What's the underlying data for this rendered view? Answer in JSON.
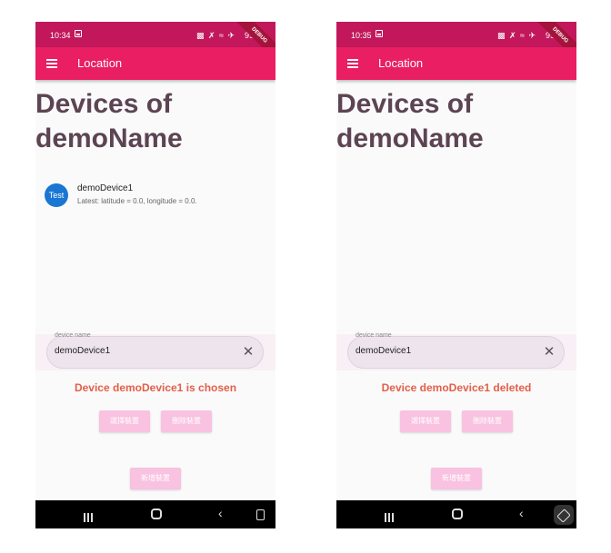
{
  "screens": [
    {
      "status_time": "10:34",
      "battery": "99%",
      "debug_label": "DEBUG",
      "app_title": "Location",
      "page_title_line1": "Devices of",
      "page_title_line2": "demoName",
      "device_list": [
        {
          "avatar": "Test",
          "title": "demoDevice1",
          "subtitle": "Latest: latitude = 0.0, longitude = 0.0."
        }
      ],
      "input_label": "device name",
      "input_value": "demoDevice1",
      "status_message": "Device demoDevice1 is chosen",
      "select_button": "選擇裝置",
      "delete_button": "刪除裝置",
      "add_button": "新增裝置"
    },
    {
      "status_time": "10:35",
      "battery": "99%",
      "debug_label": "DEBUG",
      "app_title": "Location",
      "page_title_line1": "Devices of",
      "page_title_line2": "demoName",
      "input_label": "device name",
      "input_value": "demoDevice1",
      "status_message": "Device demoDevice1 deleted",
      "select_button": "選擇裝置",
      "delete_button": "刪除裝置",
      "add_button": "新增裝置"
    }
  ],
  "colors": {
    "status_bar": "#c2185b",
    "app_bar": "#e91e63",
    "title_text": "#5d4452",
    "avatar": "#1976d2",
    "message": "#e35f4a",
    "button": "#f9c2e0"
  }
}
